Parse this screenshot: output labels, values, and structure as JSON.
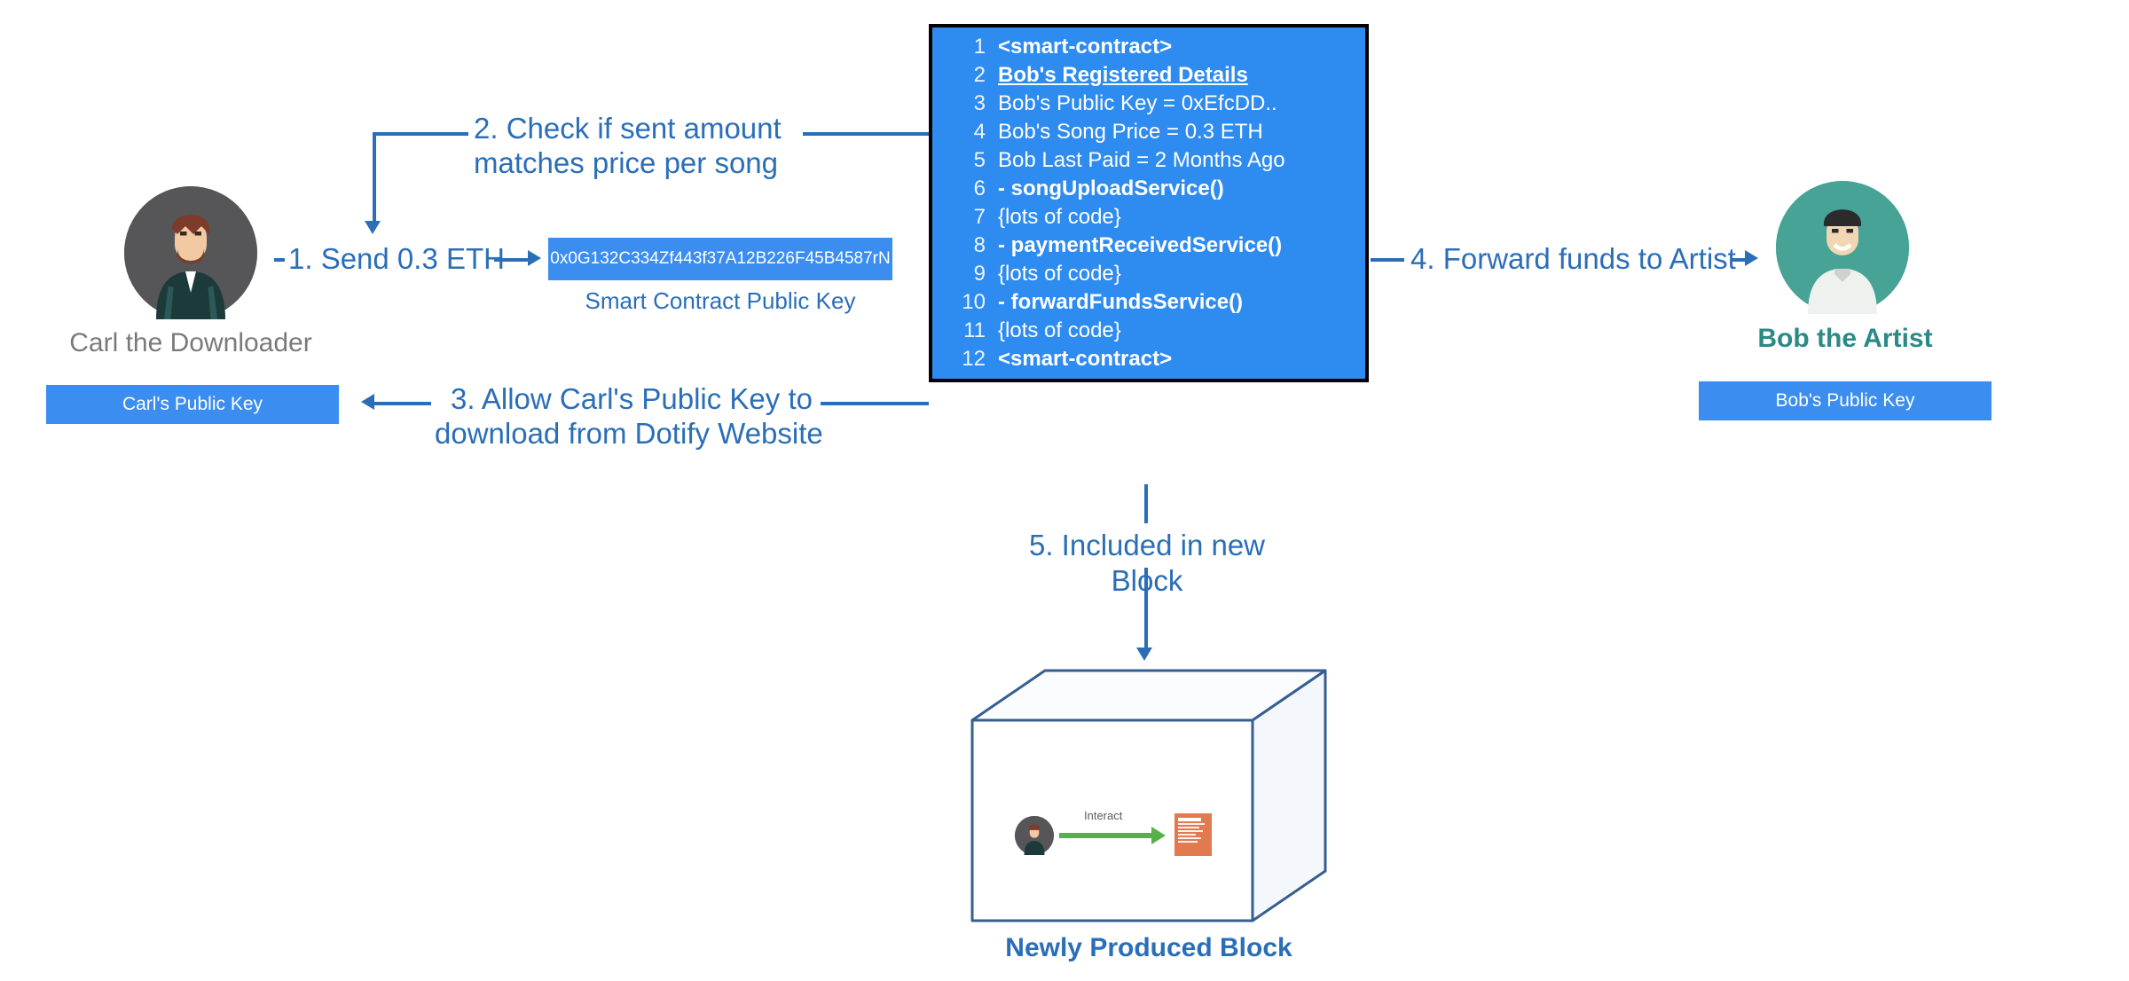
{
  "carl": {
    "label": "Carl the Downloader",
    "key_label": "Carl's Public Key"
  },
  "bob": {
    "label": "Bob the Artist",
    "key_label": "Bob's Public Key"
  },
  "smart_contract_key": {
    "value": "0x0G132C334Zf443f37A12B226F45B4587rN",
    "label": "Smart Contract Public Key"
  },
  "steps": {
    "s1": "1. Send 0.3 ETH",
    "s2a": "2. Check if sent amount",
    "s2b": "matches price per song",
    "s3a": "3. Allow Carl's Public Key to",
    "s3b": "download from Dotify Website",
    "s4": "4. Forward funds to Artist",
    "s5": "5. Included in new Block"
  },
  "contract": {
    "rows": {
      "r1": {
        "n": "1",
        "txt": "<smart-contract>",
        "style": "bold"
      },
      "r2": {
        "n": "2",
        "txt": "Bob's Registered Details",
        "style": "bold underline"
      },
      "r3": {
        "n": "3",
        "txt": "Bob's Public Key = 0xEfcDD..",
        "style": "yellow"
      },
      "r4": {
        "n": "4",
        "txt": "Bob's Song Price = 0.3 ETH",
        "style": "yellow"
      },
      "r5": {
        "n": "5",
        "txt": "Bob Last Paid = 2 Months Ago",
        "style": "yellow"
      },
      "r6": {
        "n": "6",
        "txt": "- songUploadService()",
        "style": "bold"
      },
      "r7": {
        "n": "7",
        "txt": "{lots of code}",
        "style": ""
      },
      "r8": {
        "n": "8",
        "txt": "- paymentReceivedService()",
        "style": "bold"
      },
      "r9": {
        "n": "9",
        "txt": "{lots of code}",
        "style": ""
      },
      "r10": {
        "n": "10",
        "txt": "- forwardFundsService()",
        "style": "bold"
      },
      "r11": {
        "n": "11",
        "txt": "{lots of code}",
        "style": ""
      },
      "r12": {
        "n": "12",
        "txt": "<smart-contract>",
        "style": "bold"
      }
    }
  },
  "block": {
    "label": "Newly Produced Block",
    "inner_label": "Interact"
  }
}
